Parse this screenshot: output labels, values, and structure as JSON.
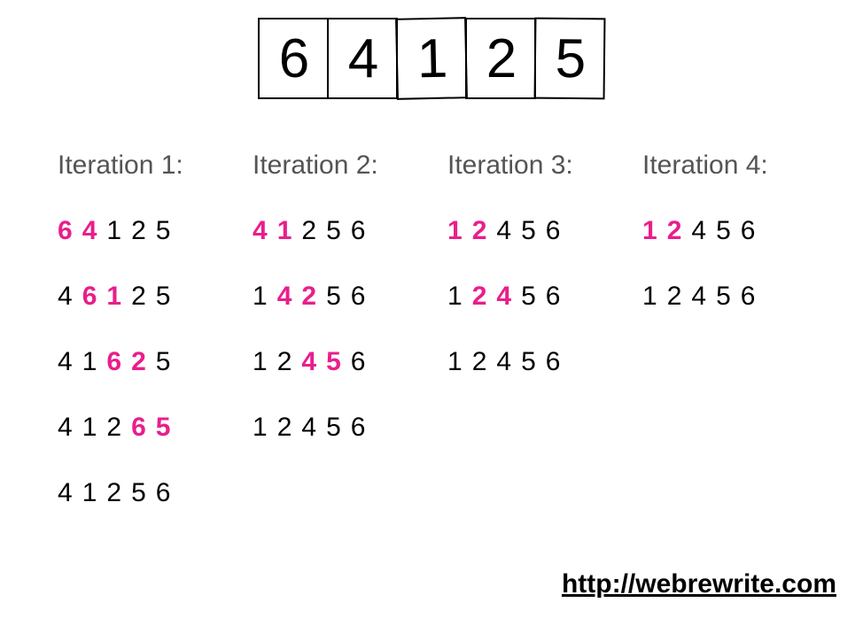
{
  "initial_array": [
    "6",
    "4",
    "1",
    "2",
    "5"
  ],
  "iterations": [
    {
      "title": "Iteration 1:",
      "steps": [
        [
          [
            "6",
            true
          ],
          [
            "4",
            true
          ],
          [
            "1",
            false
          ],
          [
            "2",
            false
          ],
          [
            "5",
            false
          ]
        ],
        [
          [
            "4",
            false
          ],
          [
            "6",
            true
          ],
          [
            "1",
            true
          ],
          [
            "2",
            false
          ],
          [
            "5",
            false
          ]
        ],
        [
          [
            "4",
            false
          ],
          [
            "1",
            false
          ],
          [
            "6",
            true
          ],
          [
            "2",
            true
          ],
          [
            "5",
            false
          ]
        ],
        [
          [
            "4",
            false
          ],
          [
            "1",
            false
          ],
          [
            "2",
            false
          ],
          [
            "6",
            true
          ],
          [
            "5",
            true
          ]
        ],
        [
          [
            "4",
            false
          ],
          [
            "1",
            false
          ],
          [
            "2",
            false
          ],
          [
            "5",
            false
          ],
          [
            "6",
            false
          ]
        ]
      ]
    },
    {
      "title": "Iteration 2:",
      "steps": [
        [
          [
            "4",
            true
          ],
          [
            "1",
            true
          ],
          [
            "2",
            false
          ],
          [
            "5",
            false
          ],
          [
            "6",
            false
          ]
        ],
        [
          [
            "1",
            false
          ],
          [
            "4",
            true
          ],
          [
            "2",
            true
          ],
          [
            "5",
            false
          ],
          [
            "6",
            false
          ]
        ],
        [
          [
            "1",
            false
          ],
          [
            "2",
            false
          ],
          [
            "4",
            true
          ],
          [
            "5",
            true
          ],
          [
            "6",
            false
          ]
        ],
        [
          [
            "1",
            false
          ],
          [
            "2",
            false
          ],
          [
            "4",
            false
          ],
          [
            "5",
            false
          ],
          [
            "6",
            false
          ]
        ]
      ]
    },
    {
      "title": "Iteration 3:",
      "steps": [
        [
          [
            "1",
            true
          ],
          [
            "2",
            true
          ],
          [
            "4",
            false
          ],
          [
            "5",
            false
          ],
          [
            "6",
            false
          ]
        ],
        [
          [
            "1",
            false
          ],
          [
            "2",
            true
          ],
          [
            "4",
            true
          ],
          [
            "5",
            false
          ],
          [
            "6",
            false
          ]
        ],
        [
          [
            "1",
            false
          ],
          [
            "2",
            false
          ],
          [
            "4",
            false
          ],
          [
            "5",
            false
          ],
          [
            "6",
            false
          ]
        ]
      ]
    },
    {
      "title": "Iteration 4:",
      "steps": [
        [
          [
            "1",
            true
          ],
          [
            "2",
            true
          ],
          [
            "4",
            false
          ],
          [
            "5",
            false
          ],
          [
            "6",
            false
          ]
        ],
        [
          [
            "1",
            false
          ],
          [
            "2",
            false
          ],
          [
            "4",
            false
          ],
          [
            "5",
            false
          ],
          [
            "6",
            false
          ]
        ]
      ]
    }
  ],
  "url": "http://webrewrite.com",
  "colors": {
    "highlight": "#e91e8c"
  }
}
